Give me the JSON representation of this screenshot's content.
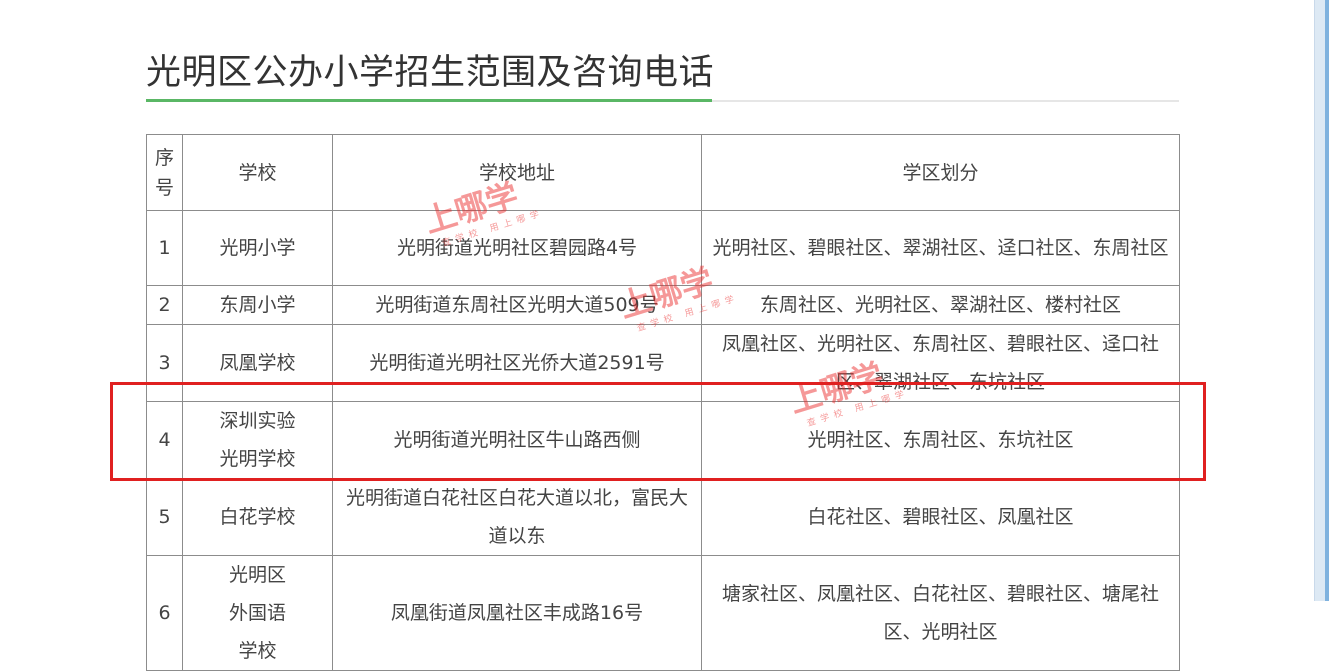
{
  "page": {
    "title": "光明区公办小学招生范围及咨询电话"
  },
  "table": {
    "headers": [
      "序号",
      "学校",
      "学校地址",
      "学区划分"
    ],
    "rows": [
      {
        "no": "1",
        "school": "光明小学",
        "address": "光明街道光明社区碧园路4号",
        "district": "光明社区、碧眼社区、翠湖社区、迳口社区、东周社区"
      },
      {
        "no": "2",
        "school": "东周小学",
        "address": "光明街道东周社区光明大道509号",
        "district": "东周社区、光明社区、翠湖社区、楼村社区"
      },
      {
        "no": "3",
        "school": "凤凰学校",
        "address": "光明街道光明社区光侨大道2591号",
        "district": "凤凰社区、光明社区、东周社区、碧眼社区、迳口社区、翠湖社区、东坑社区"
      },
      {
        "no": "4",
        "school": "深圳实验光明学校",
        "address": "光明街道光明社区牛山路西侧",
        "district": "光明社区、东周社区、东坑社区"
      },
      {
        "no": "5",
        "school": "白花学校",
        "address": "光明街道白花社区白花大道以北，富民大道以东",
        "district": "白花社区、碧眼社区、凤凰社区"
      },
      {
        "no": "6",
        "school": "光明区外国语学校",
        "address": "凤凰街道凤凰社区丰成路16号",
        "district": "塘家社区、凤凰社区、白花社区、碧眼社区、塘尾社区、光明社区"
      }
    ]
  },
  "watermark": {
    "brand": "上哪学",
    "slogan": "查学校 用上哪学"
  },
  "colors": {
    "accent_green": "#5ab765",
    "highlight_red": "#e02020",
    "watermark_red": "#eb2828",
    "border": "#8c8c8c"
  }
}
